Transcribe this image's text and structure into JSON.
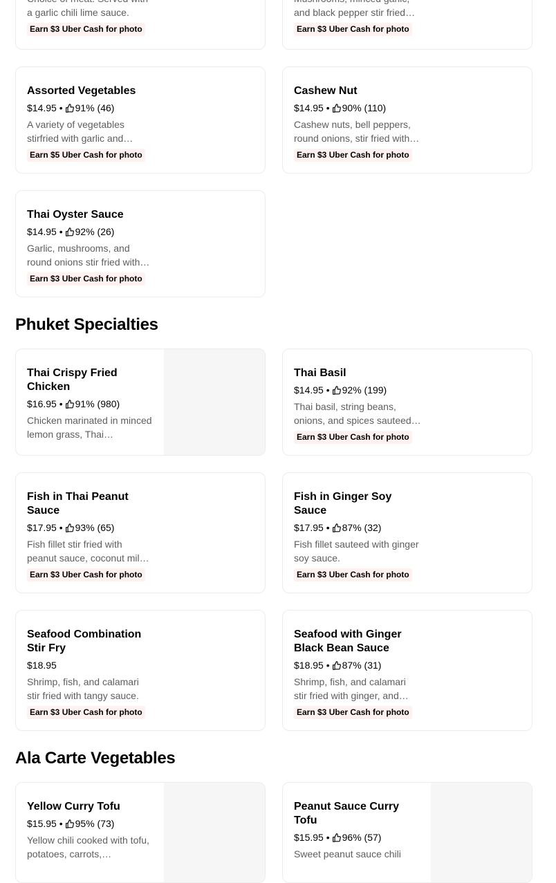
{
  "section_top": {
    "items": [
      {
        "desc": "Choice of meat. Served with a garlic chili lime sauce.",
        "promo": "Earn $3 Uber Cash for photo"
      },
      {
        "desc": "Mushrooms, minced garlic, and black pepper stir fried in…",
        "promo": "Earn $3 Uber Cash for photo"
      },
      {
        "name": "Assorted Vegetables",
        "price": "$14.95 •",
        "rating": "91% (46)",
        "desc": "A variety of vegetables stirfried with garlic and…",
        "promo": "Earn $5 Uber Cash for photo"
      },
      {
        "name": "Cashew Nut",
        "price": "$14.95 •",
        "rating": "90% (110)",
        "desc": "Cashew nuts, bell peppers, round onions, stir fried with…",
        "promo": "Earn $3 Uber Cash for photo"
      },
      {
        "name": "Thai Oyster Sauce",
        "price": "$14.95 •",
        "rating": "92% (26)",
        "desc": "Garlic, mushrooms, and round onions stir fried with…",
        "promo": "Earn $3 Uber Cash for photo"
      }
    ]
  },
  "phuket": {
    "title": "Phuket Specialties",
    "items": [
      {
        "name": "Thai Crispy Fried Chicken",
        "price": "$16.95 •",
        "rating": "91% (980)",
        "desc": "Chicken marinated in minced lemon grass, Thai…"
      },
      {
        "name": "Thai Basil",
        "price": "$14.95 •",
        "rating": "92% (199)",
        "desc": "Thai basil, string beans, onions, and spices sauteed…",
        "promo": "Earn $3 Uber Cash for photo"
      },
      {
        "name": "Fish in Thai Peanut Sauce",
        "price": "$17.95 •",
        "rating": "93% (65)",
        "desc": "Fish fillet stir fried with peanut sauce, coconut mil…",
        "promo": "Earn $3 Uber Cash for photo"
      },
      {
        "name": "Fish in Ginger Soy Sauce",
        "price": "$17.95 •",
        "rating": "87% (32)",
        "desc": "Fish fillet sauteed with ginger soy sauce.",
        "promo": "Earn $3 Uber Cash for photo"
      },
      {
        "name": "Seafood Combination Stir Fry",
        "price": "$18.95",
        "desc": "Shrimp, fish, and calamari stir fried with tangy sauce.",
        "promo": "Earn $3 Uber Cash for photo"
      },
      {
        "name": "Seafood with Ginger Black Bean Sauce",
        "price": "$18.95 •",
        "rating": "87% (31)",
        "desc": "Shrimp, fish, and calamari stir fried with ginger, and…",
        "promo": "Earn $3 Uber Cash for photo"
      }
    ]
  },
  "alacarte": {
    "title": "Ala Carte Vegetables",
    "items": [
      {
        "name": "Yellow Curry Tofu",
        "price": "$15.95 •",
        "rating": "95% (73)",
        "desc": "Yellow chili cooked with tofu, potatoes, carrots,…"
      },
      {
        "name": "Peanut Sauce Curry Tofu",
        "price": "$15.95 •",
        "rating": "96% (57)",
        "desc": "Sweet peanut sauce chili"
      }
    ]
  },
  "icons": {
    "rating": "thumbs-up-icon"
  }
}
